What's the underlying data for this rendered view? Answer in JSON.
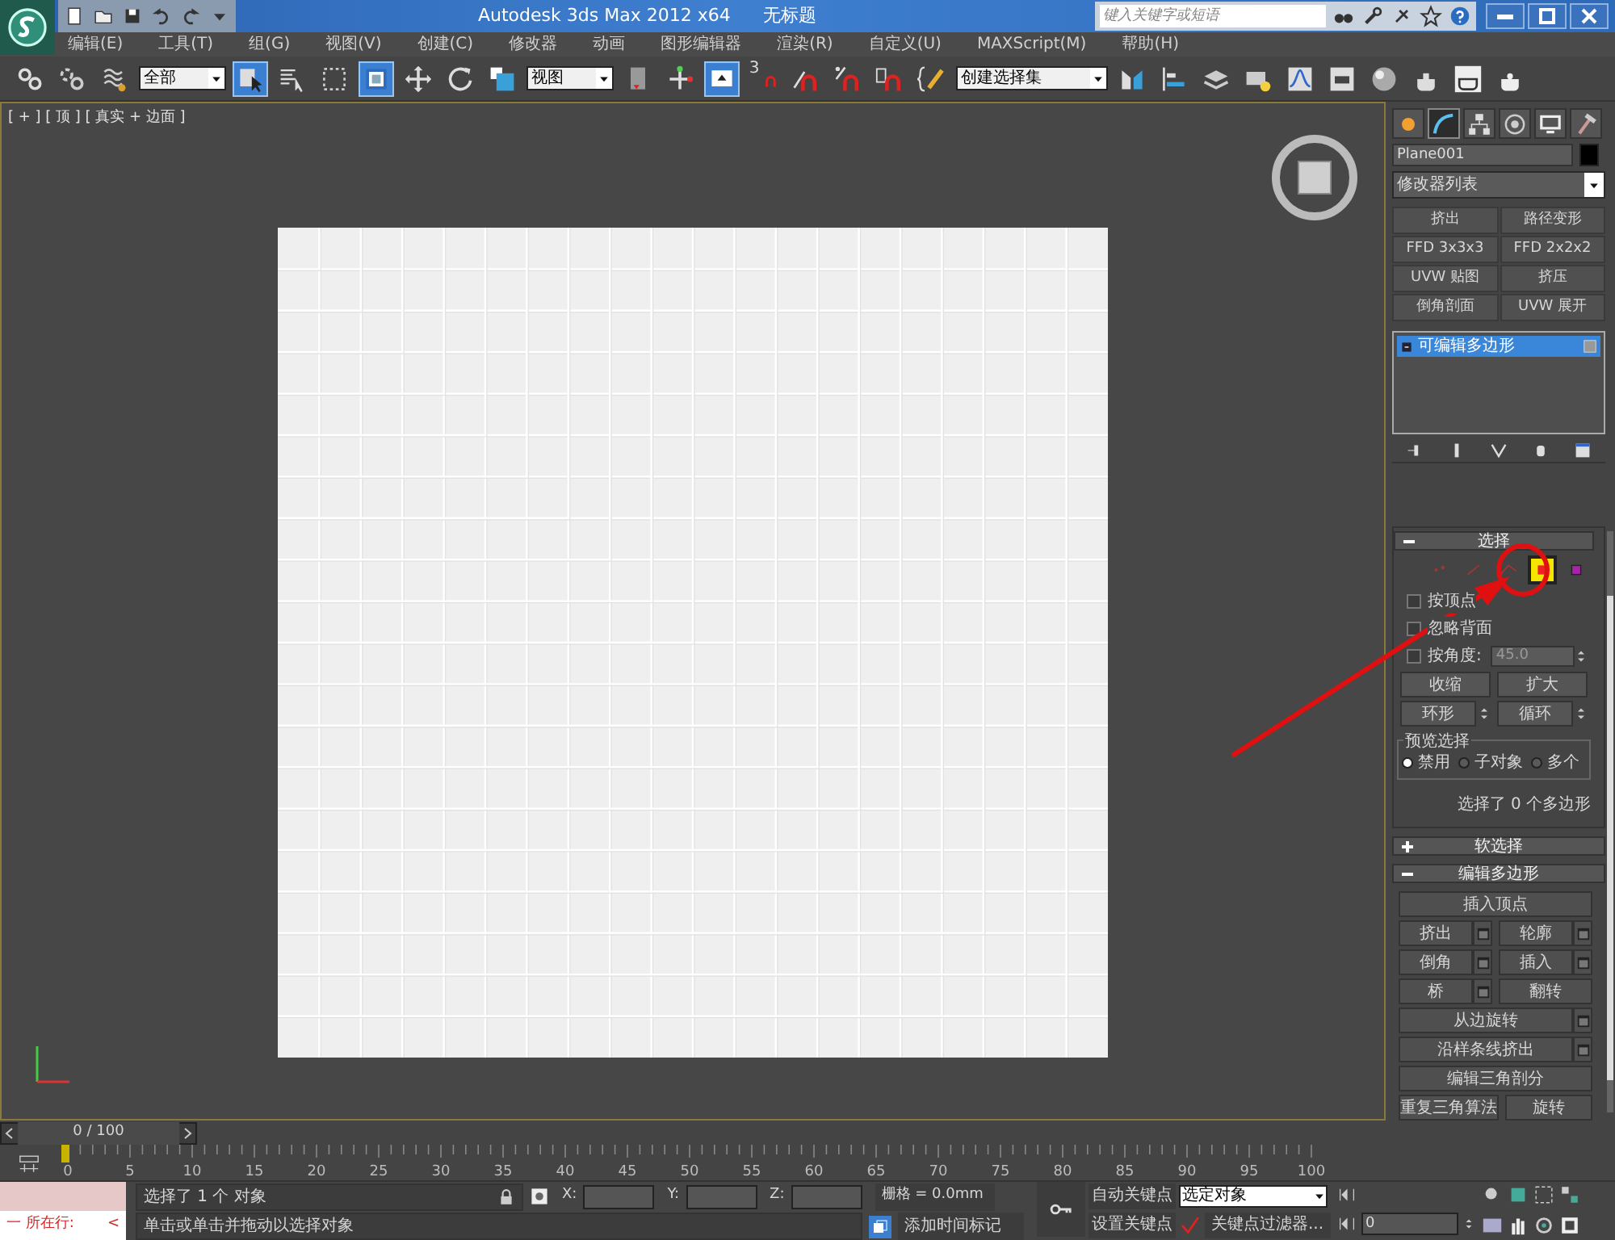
{
  "title_bar": {
    "title": "Autodesk 3ds Max  2012 x64",
    "document": "无标题",
    "search": {
      "placeholder": "键入关键字或短语"
    }
  },
  "menu": [
    "编辑(E)",
    "工具(T)",
    "组(G)",
    "视图(V)",
    "创建(C)",
    "修改器",
    "动画",
    "图形编辑器",
    "渲染(R)",
    "自定义(U)",
    "MAXScript(M)",
    "帮助(H)"
  ],
  "toolbar": [
    {
      "kind": "button",
      "selected": false
    },
    {
      "kind": "button",
      "selected": false
    },
    {
      "kind": "button",
      "selected": false
    },
    {
      "kind": "dropdown",
      "value": "全部"
    },
    {
      "kind": "button",
      "selected": true
    },
    {
      "kind": "button",
      "selected": false
    },
    {
      "kind": "button",
      "selected": false
    },
    {
      "kind": "button",
      "selected": true
    },
    {
      "kind": "button",
      "selected": false
    },
    {
      "kind": "button",
      "selected": false
    },
    {
      "kind": "button",
      "selected": false
    },
    {
      "kind": "dropdown",
      "value": "视图"
    },
    {
      "kind": "button",
      "selected": false
    },
    {
      "kind": "button",
      "selected": false
    },
    {
      "kind": "button",
      "selected": true
    },
    {
      "kind": "button",
      "selected": false,
      "label": "3"
    },
    {
      "kind": "button",
      "selected": false
    },
    {
      "kind": "button",
      "selected": false
    },
    {
      "kind": "button",
      "selected": false
    },
    {
      "kind": "button",
      "selected": false
    },
    {
      "kind": "dropdown",
      "value": "创建选择集"
    },
    {
      "kind": "button",
      "selected": false
    },
    {
      "kind": "button",
      "selected": false
    },
    {
      "kind": "button",
      "selected": false
    },
    {
      "kind": "button",
      "selected": false
    },
    {
      "kind": "button",
      "selected": false
    },
    {
      "kind": "button",
      "selected": false
    },
    {
      "kind": "button",
      "selected": false
    },
    {
      "kind": "button",
      "selected": false
    },
    {
      "kind": "button",
      "selected": false
    },
    {
      "kind": "button",
      "selected": false
    }
  ],
  "viewport": {
    "label": "[ + ] [ 顶 ] [ 真实 + 边面 ]"
  },
  "command_panel": {
    "tabs": [
      {
        "selected": false
      },
      {
        "selected": true
      },
      {
        "selected": false
      },
      {
        "selected": false
      },
      {
        "selected": false
      },
      {
        "selected": false
      }
    ],
    "object_name": "Plane001",
    "modifier_list": "修改器列表",
    "modifier_buttons": [
      "挤出",
      "路径变形",
      "FFD 3x3x3",
      "FFD 2x2x2",
      "UVW 贴图",
      "挤压",
      "倒角剖面",
      "UVW 展开"
    ],
    "stack": [
      {
        "label": "可编辑多边形",
        "selected": true
      }
    ],
    "selection": {
      "title": "选择",
      "expanded": true,
      "subobjects": [
        {
          "selected": false
        },
        {
          "selected": false
        },
        {
          "selected": false
        },
        {
          "selected": true
        },
        {
          "selected": false
        }
      ],
      "options": [
        {
          "kind": "checkbox",
          "label": "按顶点",
          "checked": false
        },
        {
          "kind": "checkbox",
          "label": "忽略背面",
          "checked": false
        },
        {
          "kind": "angle",
          "label": "按角度:",
          "checked": false,
          "value": "45.0"
        }
      ],
      "buttons": [
        "收缩",
        "扩大"
      ],
      "spin_buttons": [
        "环形",
        "循环"
      ],
      "preview": {
        "title": "预览选择",
        "options": [
          {
            "label": "禁用",
            "selected": true
          },
          {
            "label": "子对象",
            "selected": false
          },
          {
            "label": "多个",
            "selected": false
          }
        ]
      },
      "summary": "选择了 0 个多边形"
    },
    "rollouts": [
      {
        "title": "软选择",
        "expanded": false
      },
      {
        "title": "编辑多边形",
        "expanded": true
      }
    ],
    "edit_poly_rows": [
      [
        {
          "label": "插入顶点",
          "settings": false
        }
      ],
      [
        {
          "label": "挤出",
          "settings": true
        },
        {
          "label": "轮廓",
          "settings": true
        }
      ],
      [
        {
          "label": "倒角",
          "settings": true
        },
        {
          "label": "插入",
          "settings": true
        }
      ],
      [
        {
          "label": "桥",
          "settings": true
        },
        {
          "label": "翻转",
          "settings": false
        }
      ],
      [
        {
          "label": "从边旋转",
          "settings": true
        }
      ],
      [
        {
          "label": "沿样条线挤出",
          "settings": true
        }
      ],
      [
        {
          "label": "编辑三角剖分",
          "settings": false
        }
      ],
      [
        {
          "label": "重复三角算法",
          "settings": false
        },
        {
          "label": "旋转",
          "settings": false
        }
      ]
    ]
  },
  "timeline": {
    "frame": "0 / 100",
    "ruler": [
      "0",
      "5",
      "10",
      "15",
      "20",
      "25",
      "30",
      "35",
      "40",
      "45",
      "50",
      "55",
      "60",
      "65",
      "70",
      "75",
      "80",
      "85",
      "90",
      "95",
      "100"
    ]
  },
  "status": {
    "listener": "一  所在行:",
    "listener_arrow": "<",
    "selection": "选择了 1 个 对象",
    "prompt": "单击或单击并拖动以选择对象",
    "coords": [
      "X:",
      "Y:",
      "Z:"
    ],
    "grid": "栅格 = 0.0mm",
    "time_tag": "添加时间标记",
    "auto_key": "自动关键点",
    "set_key": "设置关键点",
    "key_mode": "选定对象",
    "key_filters": "关键点过滤器...",
    "frame": "0"
  }
}
